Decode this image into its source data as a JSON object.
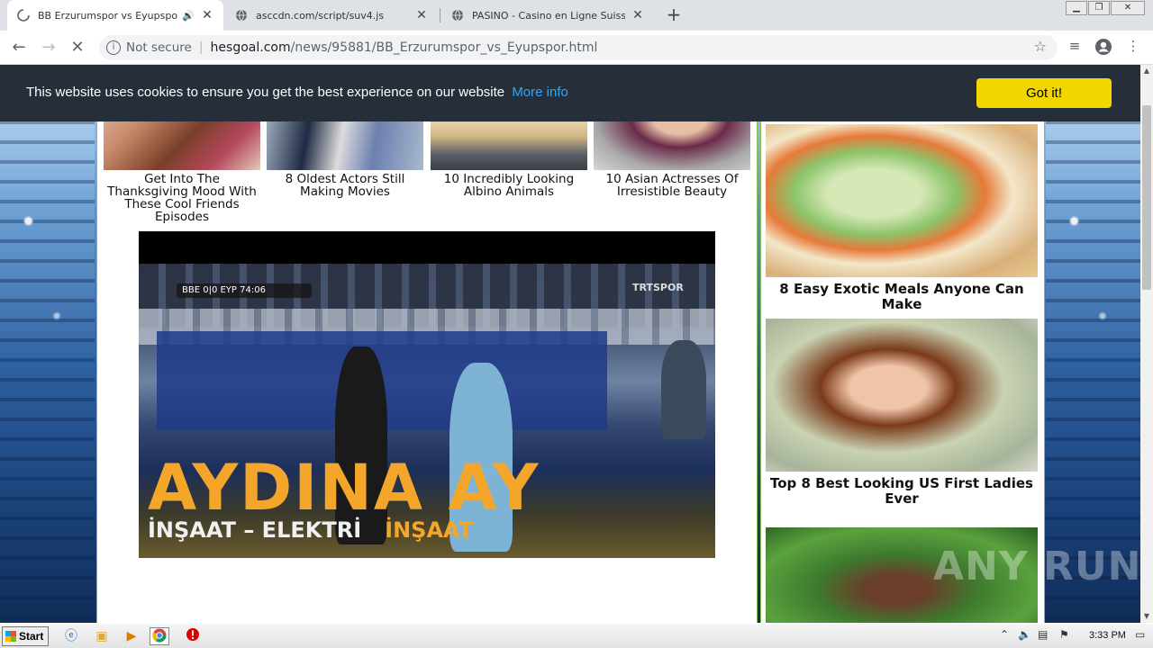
{
  "tabs": [
    {
      "title": "BB Erzurumspor vs Eyupspor - H",
      "active": true
    },
    {
      "title": "asccdn.com/script/suv4.js",
      "active": false
    },
    {
      "title": "PASINO - Casino en Ligne Suisse - Sü",
      "active": false
    }
  ],
  "address": {
    "not_secure": "Not secure",
    "host": "hesgoal.com",
    "path": "/news/95881/BB_Erzurumspor_vs_Eyupspor.html"
  },
  "cookie": {
    "text": "This website uses cookies to ensure you get the best experience on our website",
    "link": "More info",
    "button": "Got it!"
  },
  "ads_row": [
    {
      "caption": "Get Into The Thanksgiving Mood With These Cool Friends Episodes"
    },
    {
      "caption": "8 Oldest Actors Still Making Movies"
    },
    {
      "caption": "10 Incredibly Looking Albino Animals"
    },
    {
      "caption": "10 Asian Actresses Of Irresistible Beauty"
    }
  ],
  "video": {
    "scorebug": "BBE 0|0 EYP 74:06",
    "channel": "TRTSPOR",
    "banner": "AYDINA AY",
    "banner_sub": "İNŞAAT – ELEKTRİ",
    "banner_sub2": "İNŞAAT"
  },
  "right_ads": [
    {
      "caption": "8 Easy Exotic Meals Anyone Can Make"
    },
    {
      "caption": "Top 8 Best Looking US First Ladies Ever"
    },
    {
      "caption": ""
    }
  ],
  "watermark": "ANY RUN",
  "taskbar": {
    "start": "Start",
    "clock": "3:33 PM"
  }
}
